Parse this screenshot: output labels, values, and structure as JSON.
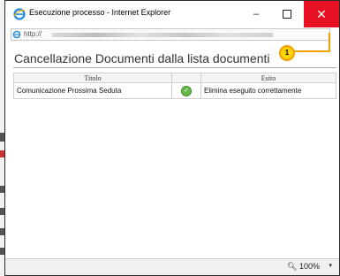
{
  "window": {
    "title": "Esecuzione processo - Internet Explorer",
    "min_glyph": "–",
    "close_glyph": "✕"
  },
  "address": {
    "url": "http://"
  },
  "callout": {
    "number": "1"
  },
  "page": {
    "title": "Cancellazione Documenti dalla lista documenti"
  },
  "table": {
    "headers": [
      "Titolo",
      "Esito"
    ],
    "rows": [
      {
        "titolo": "Comunicazione Prossima Seduta",
        "status_icon": "ok-icon",
        "esito": "Elimina eseguito correttamente"
      }
    ]
  },
  "status_bar": {
    "zoom": "100%",
    "zoom_caret": "▾"
  },
  "colors": {
    "close_button": "#e81123",
    "callout_fill": "#ffd400",
    "callout_stroke": "#f0a000"
  }
}
